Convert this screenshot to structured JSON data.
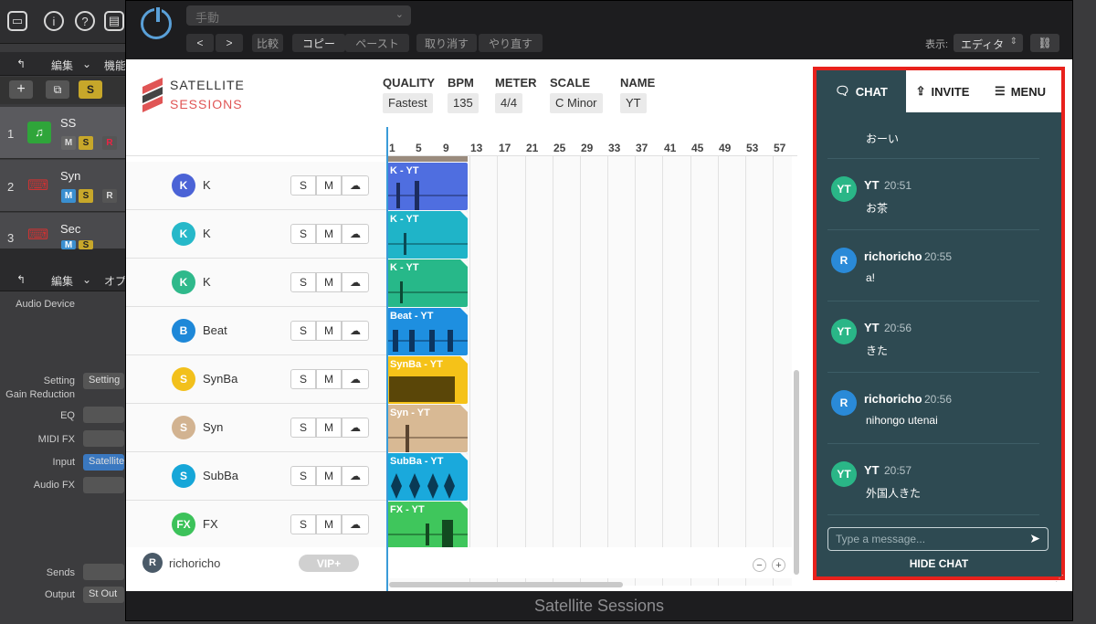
{
  "host": {
    "left_bar1": {
      "edit": "編集",
      "func": "機能"
    },
    "left_bar2": {
      "edit": "編集",
      "opt": "オプ"
    },
    "tracks": [
      {
        "num": "1",
        "name": "SS"
      },
      {
        "num": "2",
        "name": "Syn"
      },
      {
        "num": "3",
        "name": "Sec"
      }
    ],
    "inspector_labels": [
      "Audio Device",
      "Setting",
      "Gain Reduction",
      "EQ",
      "MIDI FX",
      "Input",
      "Audio FX",
      "Sends",
      "Output"
    ],
    "inspector_values": {
      "setting": "Setting",
      "input": "Satellite",
      "output": "St Out"
    },
    "s_button": "S"
  },
  "plugin": {
    "preset": "手動",
    "buttons": {
      "compare": "比較",
      "copy": "コピー",
      "paste": "ペースト",
      "undo": "取り消す",
      "redo": "やり直す"
    },
    "view_label": "表示:",
    "view_value": "エディタ",
    "footer": "Satellite Sessions"
  },
  "app": {
    "logo": {
      "line1": "SATELLITE",
      "line2": "SESSIONS"
    },
    "meta": [
      {
        "label": "QUALITY",
        "value": "Fastest"
      },
      {
        "label": "BPM",
        "value": "135"
      },
      {
        "label": "METER",
        "value": "4/4"
      },
      {
        "label": "SCALE",
        "value": "C Minor"
      },
      {
        "label": "NAME",
        "value": "YT"
      }
    ],
    "ruler": [
      "1",
      "5",
      "9",
      "13",
      "17",
      "21",
      "25",
      "29",
      "33",
      "37",
      "41",
      "45",
      "49",
      "53",
      "57"
    ],
    "track_buttons": {
      "s": "S",
      "m": "M"
    },
    "tracks": [
      {
        "initial": "K",
        "name": "K",
        "color": "#4b63d6",
        "region": "K - YT",
        "region_color": "#4f6ee0"
      },
      {
        "initial": "K",
        "name": "K",
        "color": "#26b8c9",
        "region": "K - YT",
        "region_color": "#1fb4c8"
      },
      {
        "initial": "K",
        "name": "K",
        "color": "#2fb98b",
        "region": "K - YT",
        "region_color": "#27b889"
      },
      {
        "initial": "B",
        "name": "Beat",
        "color": "#1e88d8",
        "region": "Beat - YT",
        "region_color": "#1e8fe0"
      },
      {
        "initial": "S",
        "name": "SynBa",
        "color": "#f2c01c",
        "region": "SynBa - YT",
        "region_color": "#f5c218"
      },
      {
        "initial": "S",
        "name": "Syn",
        "color": "#d2b391",
        "region": "Syn - YT",
        "region_color": "#d8b994"
      },
      {
        "initial": "S",
        "name": "SubBa",
        "color": "#16a6d8",
        "region": "SubBa - YT",
        "region_color": "#1aa9dc"
      },
      {
        "initial": "FX",
        "name": "FX",
        "color": "#3cc25a",
        "region": "FX - YT",
        "region_color": "#3fc65c"
      }
    ],
    "user": {
      "initial": "R",
      "name": "richoricho",
      "badge": "VIP+"
    },
    "zoom": {
      "out": "−",
      "in": "+"
    }
  },
  "chat": {
    "tabs": [
      {
        "label": "CHAT",
        "icon": "chat-icon"
      },
      {
        "label": "INVITE",
        "icon": "share-icon"
      },
      {
        "label": "MENU",
        "icon": "menu-icon"
      }
    ],
    "partial_message": "おーい",
    "messages": [
      {
        "initial": "YT",
        "user": "YT",
        "time": "20:51",
        "text": "お茶",
        "color": "#2ab687"
      },
      {
        "initial": "R",
        "user": "richoricho",
        "time": "20:55",
        "text": "a!",
        "color": "#2a8ad8"
      },
      {
        "initial": "YT",
        "user": "YT",
        "time": "20:56",
        "text": "きた",
        "color": "#2ab687"
      },
      {
        "initial": "R",
        "user": "richoricho",
        "time": "20:56",
        "text": "nihongo utenai",
        "color": "#2a8ad8"
      },
      {
        "initial": "YT",
        "user": "YT",
        "time": "20:57",
        "text": "外国人きた",
        "color": "#2ab687"
      }
    ],
    "input_placeholder": "Type a message...",
    "hide_label": "HIDE CHAT"
  }
}
